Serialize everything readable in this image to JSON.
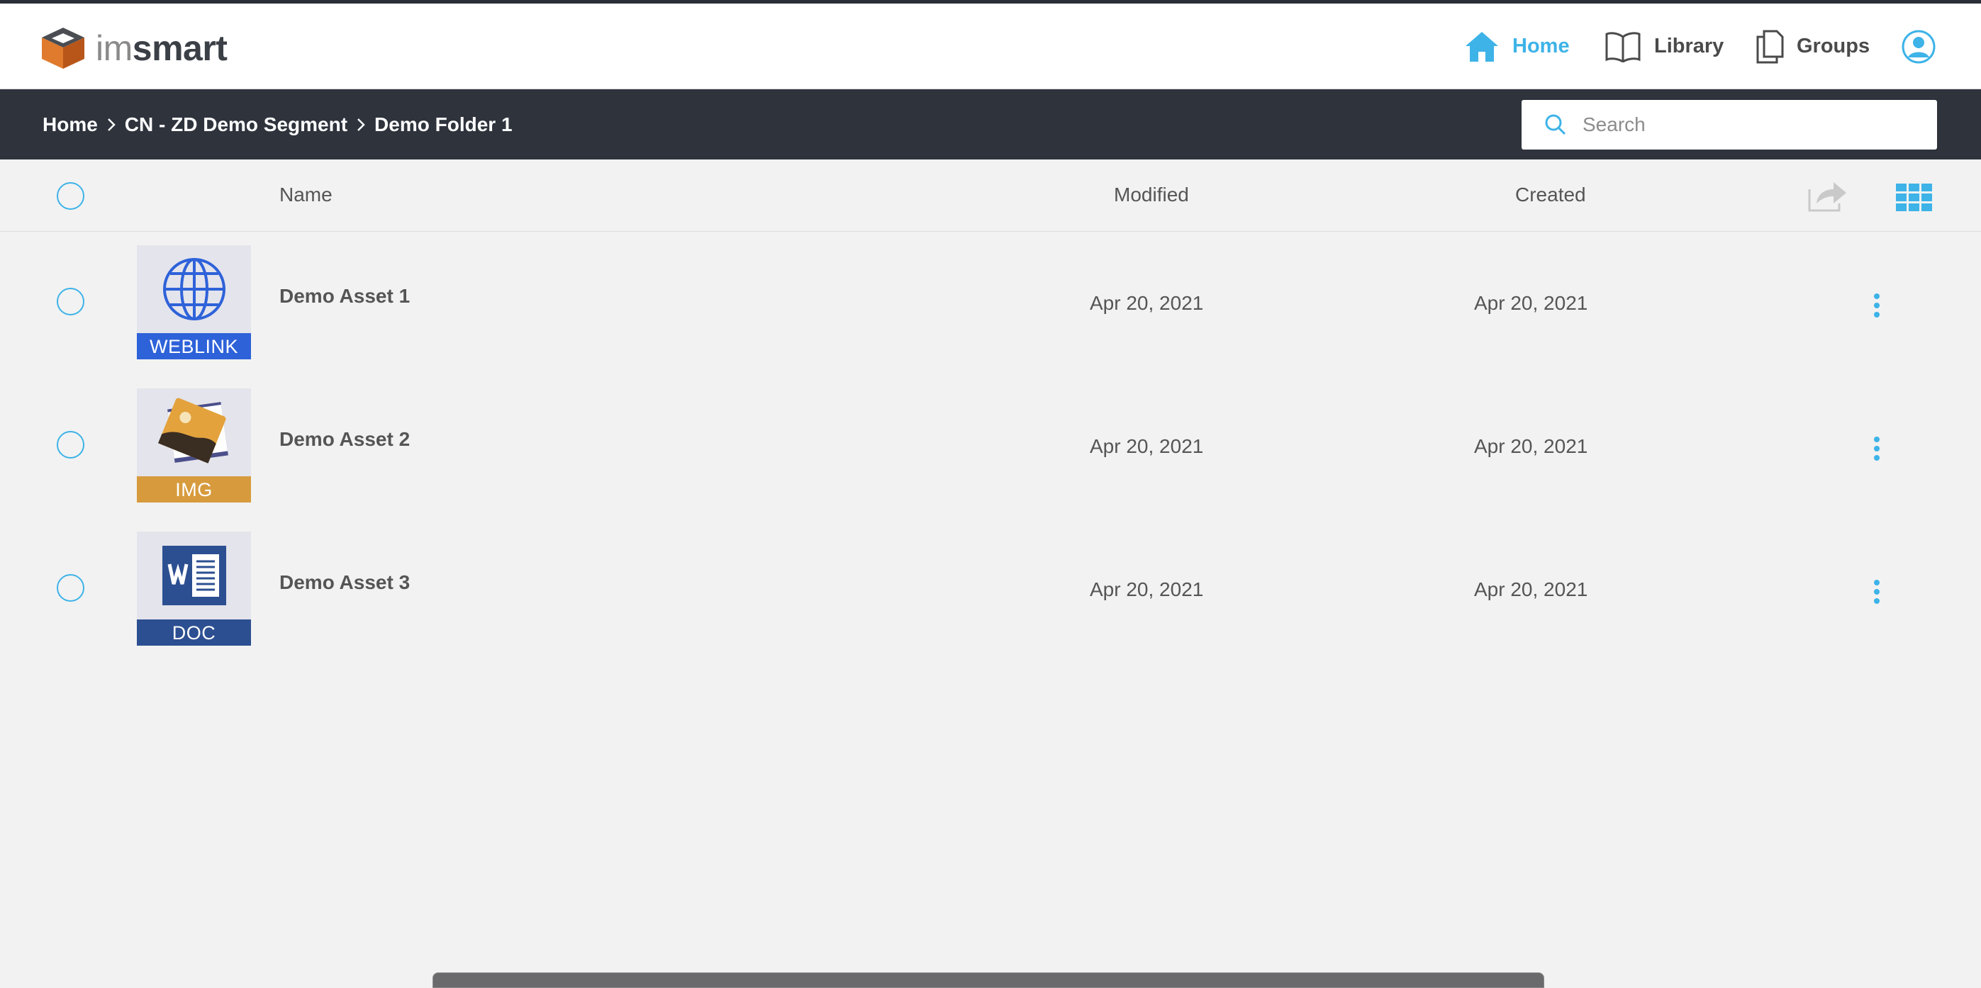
{
  "app": {
    "logo_im": "im",
    "logo_smart": "smart"
  },
  "nav": {
    "home": "Home",
    "library": "Library",
    "groups": "Groups"
  },
  "breadcrumb": [
    "Home",
    "CN - ZD Demo Segment",
    "Demo Folder 1"
  ],
  "search": {
    "placeholder": "Search",
    "value": ""
  },
  "columns": {
    "name": "Name",
    "modified": "Modified",
    "created": "Created"
  },
  "assets": [
    {
      "name": "Demo Asset 1",
      "type": "WEBLINK",
      "modified": "Apr 20, 2021",
      "created": "Apr 20, 2021",
      "band_color": "#2e62d9",
      "icon": "globe-icon"
    },
    {
      "name": "Demo Asset 2",
      "type": "IMG",
      "modified": "Apr 20, 2021",
      "created": "Apr 20, 2021",
      "band_color": "#d79b3d",
      "icon": "image-icon"
    },
    {
      "name": "Demo Asset 3",
      "type": "DOC",
      "modified": "Apr 20, 2021",
      "created": "Apr 20, 2021",
      "band_color": "#2c4f91",
      "icon": "word-doc-icon"
    }
  ],
  "colors": {
    "accent": "#3db3e8",
    "subbar": "#2e333c",
    "background": "#f2f2f2"
  }
}
